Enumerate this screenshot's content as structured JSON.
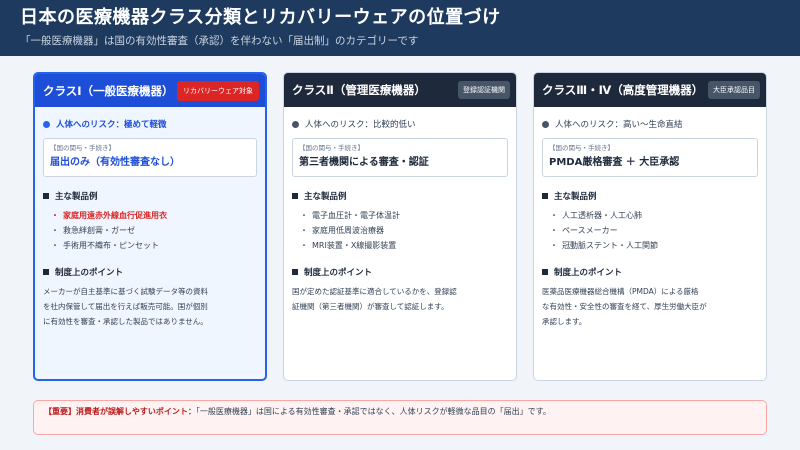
{
  "header": {
    "title": "日本の医療機器クラス分類とリカバリーウェアの位置づけ",
    "subtitle": "「一般医療機器」は国の有効性審査（承認）を伴わない「届出制」のカテゴリーです"
  },
  "cards": [
    {
      "title": "クラスⅠ（一般医療機器）",
      "badge": "リカバリーウェア対象",
      "risk": "人体へのリスク：極めて軽微",
      "proc_label": "【国の関与・手続き】",
      "proc_value": "届出のみ（有効性審査なし）",
      "examples_title": "主な製品例",
      "examples": [
        "家庭用遠赤外線血行促進用衣",
        "救急絆創膏・ガーゼ",
        "手術用不織布・ピンセット"
      ],
      "highlight_index": 0,
      "point_title": "制度上のポイント",
      "point_lines": [
        "メーカーが自主基準に基づく試験データ等の資料",
        "を社内保管して届出を行えば販売可能。国が個別",
        "に有効性を審査・承認した製品ではありません。"
      ]
    },
    {
      "title": "クラスⅡ（管理医療機器）",
      "badge": "登録認証機関",
      "risk": "人体へのリスク：比較的低い",
      "proc_label": "【国の関与・手続き】",
      "proc_value": "第三者機関による審査・認証",
      "examples_title": "主な製品例",
      "examples": [
        "電子血圧計・電子体温計",
        "家庭用低周波治療器",
        "MRI装置・X線撮影装置"
      ],
      "point_title": "制度上のポイント",
      "point_lines": [
        "国が定めた認証基準に適合しているかを、登録認",
        "証機関（第三者機関）が審査して認証します。"
      ]
    },
    {
      "title": "クラスⅢ・Ⅳ（高度管理機器）",
      "badge": "大臣承認品目",
      "risk": "人体へのリスク：高い～生命直結",
      "proc_label": "【国の関与・手続き】",
      "proc_value": "PMDA厳格審査 ＋ 大臣承認",
      "examples_title": "主な製品例",
      "examples": [
        "人工透析器・人工心肺",
        "ペースメーカー",
        "冠動脈ステント・人工関節"
      ],
      "point_title": "制度上のポイント",
      "point_lines": [
        "医薬品医療機器総合機構（PMDA）による厳格",
        "な有効性・安全性の審査を経て、厚生労働大臣が",
        "承認します。"
      ]
    }
  ],
  "note": {
    "strong": "【重要】消費者が誤解しやすいポイント：",
    "text": "「一般医療機器」は国による有効性審査・承認ではなく、人体リスクが軽微な品目の「届出」です。"
  },
  "bullet_mark": "・"
}
